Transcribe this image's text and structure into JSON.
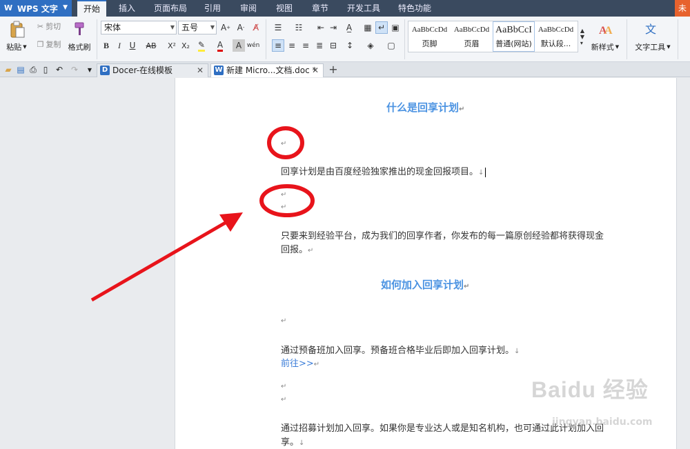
{
  "app": {
    "name": "WPS 文字",
    "menu_tabs": [
      "开始",
      "插入",
      "页面布局",
      "引用",
      "审阅",
      "视图",
      "章节",
      "开发工具",
      "特色功能"
    ],
    "unregistered": "未"
  },
  "ribbon": {
    "paste": "粘贴",
    "cut": "剪切",
    "copy": "复制",
    "format_painter": "格式刷",
    "font_name": "宋体",
    "font_size": "五号",
    "styles": [
      {
        "sample": "AaBbCcDd",
        "name": "页脚"
      },
      {
        "sample": "AaBbCcDd",
        "name": "页眉"
      },
      {
        "sample": "AaBbCcI",
        "name": "普通(网站)"
      },
      {
        "sample": "AaBbCcDd",
        "name": "默认段..."
      }
    ],
    "new_style": "新样式",
    "text_tools": "文字工具"
  },
  "tabs": {
    "docer": "Docer-在线模板",
    "doc": "新建 Micro...文档.doc *"
  },
  "document": {
    "heading1": "什么是回享计划",
    "para1": "回享计划是由百度经验独家推出的现金回报项目。",
    "para2_line1": "只要来到经验平台，成为我们的回享作者，你发布的每一篇原创经验都将获得现金",
    "para2_line2": "回报。",
    "heading2": "如何加入回享计划",
    "para3": "通过预备班加入回享。预备班合格毕业后即加入回享计划。",
    "link": "前往>>",
    "para4_line1": "通过招募计划加入回享。如果你是专业达人或是知名机构，也可通过此计划加入回",
    "para4_line2": "享。",
    "para_mark": "↵",
    "line_break_mark": "↓"
  },
  "watermark": {
    "brand": "Baidu 经验",
    "url": "jingyan.baidu.com"
  },
  "colors": {
    "accent": "#2f6fc2",
    "heading": "#4b93e2",
    "annotation": "#e8141b"
  }
}
